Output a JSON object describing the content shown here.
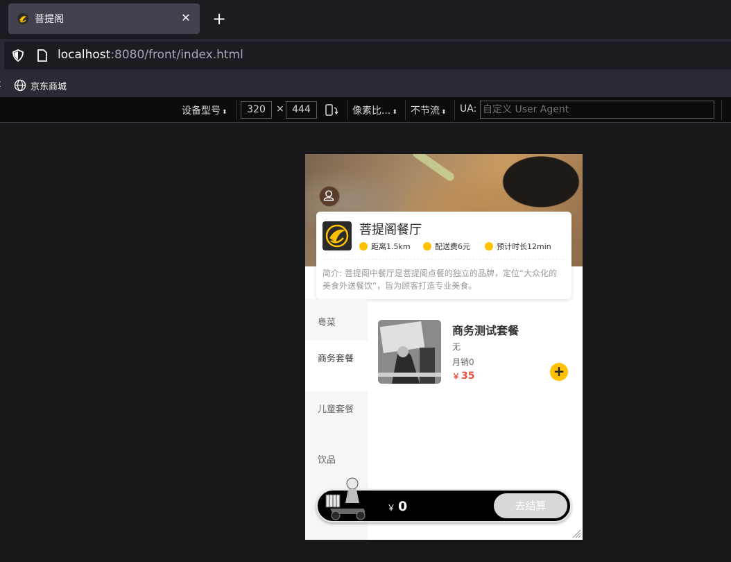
{
  "browser": {
    "tab_title": "菩提阁",
    "tab_close": "✕",
    "new_tab": "+",
    "url_host": "localhost",
    "url_path": ":8080/front/index.html",
    "bookmark_edge": "t",
    "bookmark_label": "京东商城"
  },
  "rdm": {
    "device_label": "设备型号",
    "width": "320",
    "times": "×",
    "height": "444",
    "pixel_ratio": "像素比...",
    "throttle": "不节流",
    "ua_label": "UA:",
    "ua_placeholder": "自定义 User Agent"
  },
  "shop": {
    "name": "菩提阁餐厅",
    "distance": "距离1.5km",
    "delivery_fee": "配送费6元",
    "eta": "预计时长12min",
    "intro": "简介: 菩提阁中餐厅是菩提阁点餐的独立的品牌，定位“大众化的美食外送餐饮”，旨为顾客打造专业美食。"
  },
  "categories": [
    {
      "label": "粤菜",
      "active": false
    },
    {
      "label": "商务套餐",
      "active": true
    },
    {
      "label": "儿童套餐",
      "active": false
    },
    {
      "label": "饮品",
      "active": false
    }
  ],
  "dish": {
    "name": "商务测试套餐",
    "description": "无",
    "sales": "月销0",
    "currency": "￥",
    "price": "35",
    "add": "+"
  },
  "cart": {
    "currency": "￥",
    "total": "0",
    "checkout_label": "去结算"
  },
  "colors": {
    "accent_yellow": "#ffc200",
    "price_red": "#e94e3c",
    "cart_black": "#000000",
    "checkout_disabled": "#d8d8d8"
  }
}
